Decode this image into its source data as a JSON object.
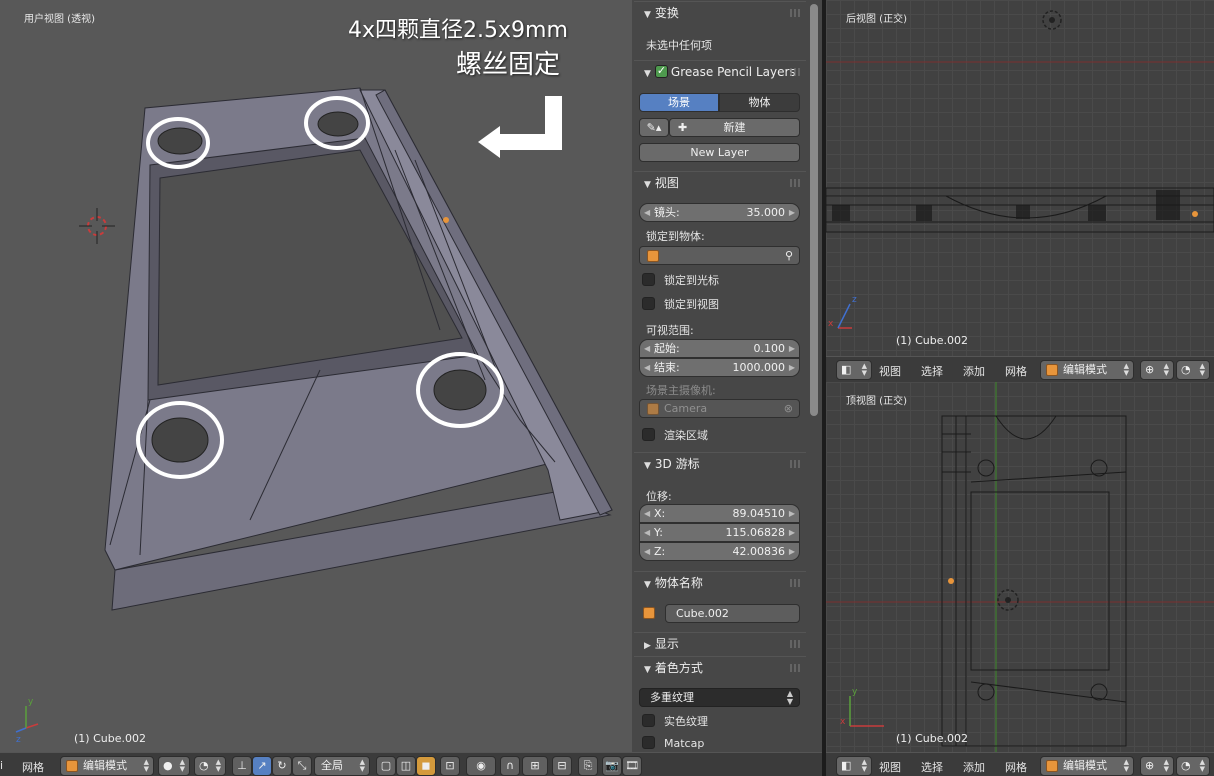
{
  "main_view": {
    "title": "用户视图 (透视)",
    "object": "(1) Cube.002",
    "annotation_line1": "4x四颗直径2.5x9mm",
    "annotation_line2": "螺丝固定"
  },
  "properties": {
    "transform": {
      "title": "变换",
      "nothing_selected": "未选中任何项"
    },
    "grease_pencil": {
      "title": "Grease Pencil Layers",
      "enabled": true,
      "tab_scene": "场景",
      "tab_object": "物体",
      "new_label": "新建",
      "new_layer_label": "New Layer"
    },
    "view": {
      "title": "视图",
      "lens_label": "镜头:",
      "lens_value": "35.000",
      "lock_object_label": "锁定到物体:",
      "lock_cursor_label": "锁定到光标",
      "lock_view_label": "锁定到视图",
      "clip_label": "可视范围:",
      "clip_start_label": "起始:",
      "clip_start_value": "0.100",
      "clip_end_label": "结束:",
      "clip_end_value": "1000.000",
      "camera_label": "场景主摄像机:",
      "camera_value": "Camera",
      "render_border_label": "渲染区域"
    },
    "cursor": {
      "title": "3D 游标",
      "location_label": "位移:",
      "x_label": "X:",
      "x_value": "89.04510",
      "y_label": "Y:",
      "y_value": "115.06828",
      "z_label": "Z:",
      "z_value": "42.00836"
    },
    "item": {
      "title": "物体名称",
      "name": "Cube.002"
    },
    "display": {
      "title": "显示"
    },
    "shading": {
      "title": "着色方式",
      "mode": "多重纹理",
      "solid_tex_label": "实色纹理",
      "matcap_label": "Matcap"
    }
  },
  "back_view": {
    "title": "后视图 (正交)",
    "object": "(1) Cube.002"
  },
  "top_view": {
    "title": "顶视图 (正交)",
    "object": "(1) Cube.002"
  },
  "toolbar_main": {
    "edge_label": "i",
    "mesh_label": "网格",
    "mode_label": "编辑模式",
    "pivot_label": "全局"
  },
  "toolbar_back": {
    "view_label": "视图",
    "select_label": "选择",
    "add_label": "添加",
    "mesh_label": "网格",
    "mode_label": "编辑模式"
  },
  "toolbar_top": {
    "view_label": "视图",
    "select_label": "选择",
    "add_label": "添加",
    "mesh_label": "网格",
    "mode_label": "编辑模式"
  },
  "colors": {
    "accent_blue": "#5680c2",
    "object_orange": "#e8953b",
    "axis_red": "#c83c3c",
    "axis_green": "#5aa03c",
    "mesh_face": "#7b7a8a"
  }
}
